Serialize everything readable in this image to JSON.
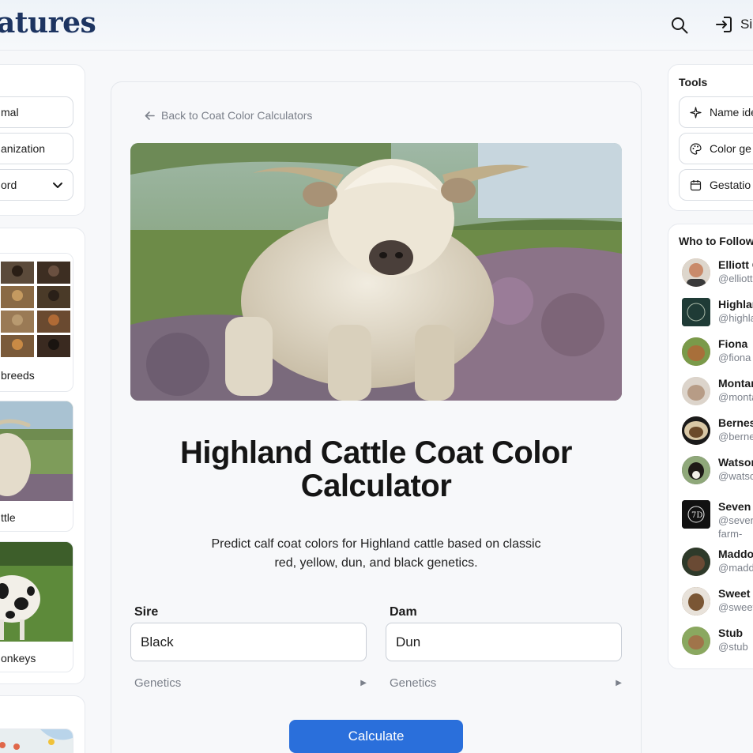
{
  "header": {
    "logo": "atures",
    "signin_label": "Si"
  },
  "left": {
    "filters": [
      {
        "label": "mal"
      },
      {
        "label": "anization"
      },
      {
        "label": "ord"
      }
    ],
    "tiles": [
      {
        "caption": " breeds"
      },
      {
        "caption": "ttle"
      },
      {
        "caption": "onkeys"
      }
    ]
  },
  "main": {
    "back_label": "Back to Coat Color Calculators",
    "title": "Highland Cattle Coat Color Calculator",
    "description": "Predict calf coat colors for Highland cattle based on classic red, yellow, dun, and black genetics.",
    "sire_label": "Sire",
    "sire_value": "Black",
    "dam_label": "Dam",
    "dam_value": "Dun",
    "genetics_label": "Genetics",
    "calculate_label": "Calculate"
  },
  "right": {
    "tools_title": "Tools",
    "tools": [
      {
        "label": "Name ide",
        "icon": "sparkle-icon"
      },
      {
        "label": "Color ge",
        "icon": "palette-icon"
      },
      {
        "label": "Gestatio",
        "icon": "calendar-icon"
      }
    ],
    "follow_title": "Who to Follow",
    "people": [
      {
        "name": "Elliott G",
        "handle": "@elliott",
        "color": "#c98a6a"
      },
      {
        "name": "Highlar",
        "handle": "@highla",
        "color": "#1f3b36"
      },
      {
        "name": "Fiona",
        "handle": "@fiona",
        "color": "#8a6a3a"
      },
      {
        "name": "Montar",
        "handle": "@monta",
        "color": "#c7b9aa"
      },
      {
        "name": "Bernes",
        "handle": "@berne",
        "color": "#6b4a2a"
      },
      {
        "name": "Watsor",
        "handle": "@watso",
        "color": "#2e2a26"
      },
      {
        "name": "Seven I",
        "handle": "@seven farm-",
        "color": "#111111"
      },
      {
        "name": "Maddo",
        "handle": "@madd",
        "color": "#4a3526"
      },
      {
        "name": "Sweet",
        "handle": "@sweet",
        "color": "#7a5634"
      },
      {
        "name": "Stub",
        "handle": "@stub",
        "color": "#8a7a4a"
      }
    ]
  },
  "colors": {
    "brand": "#1d3461",
    "accent": "#2a6fdb"
  }
}
